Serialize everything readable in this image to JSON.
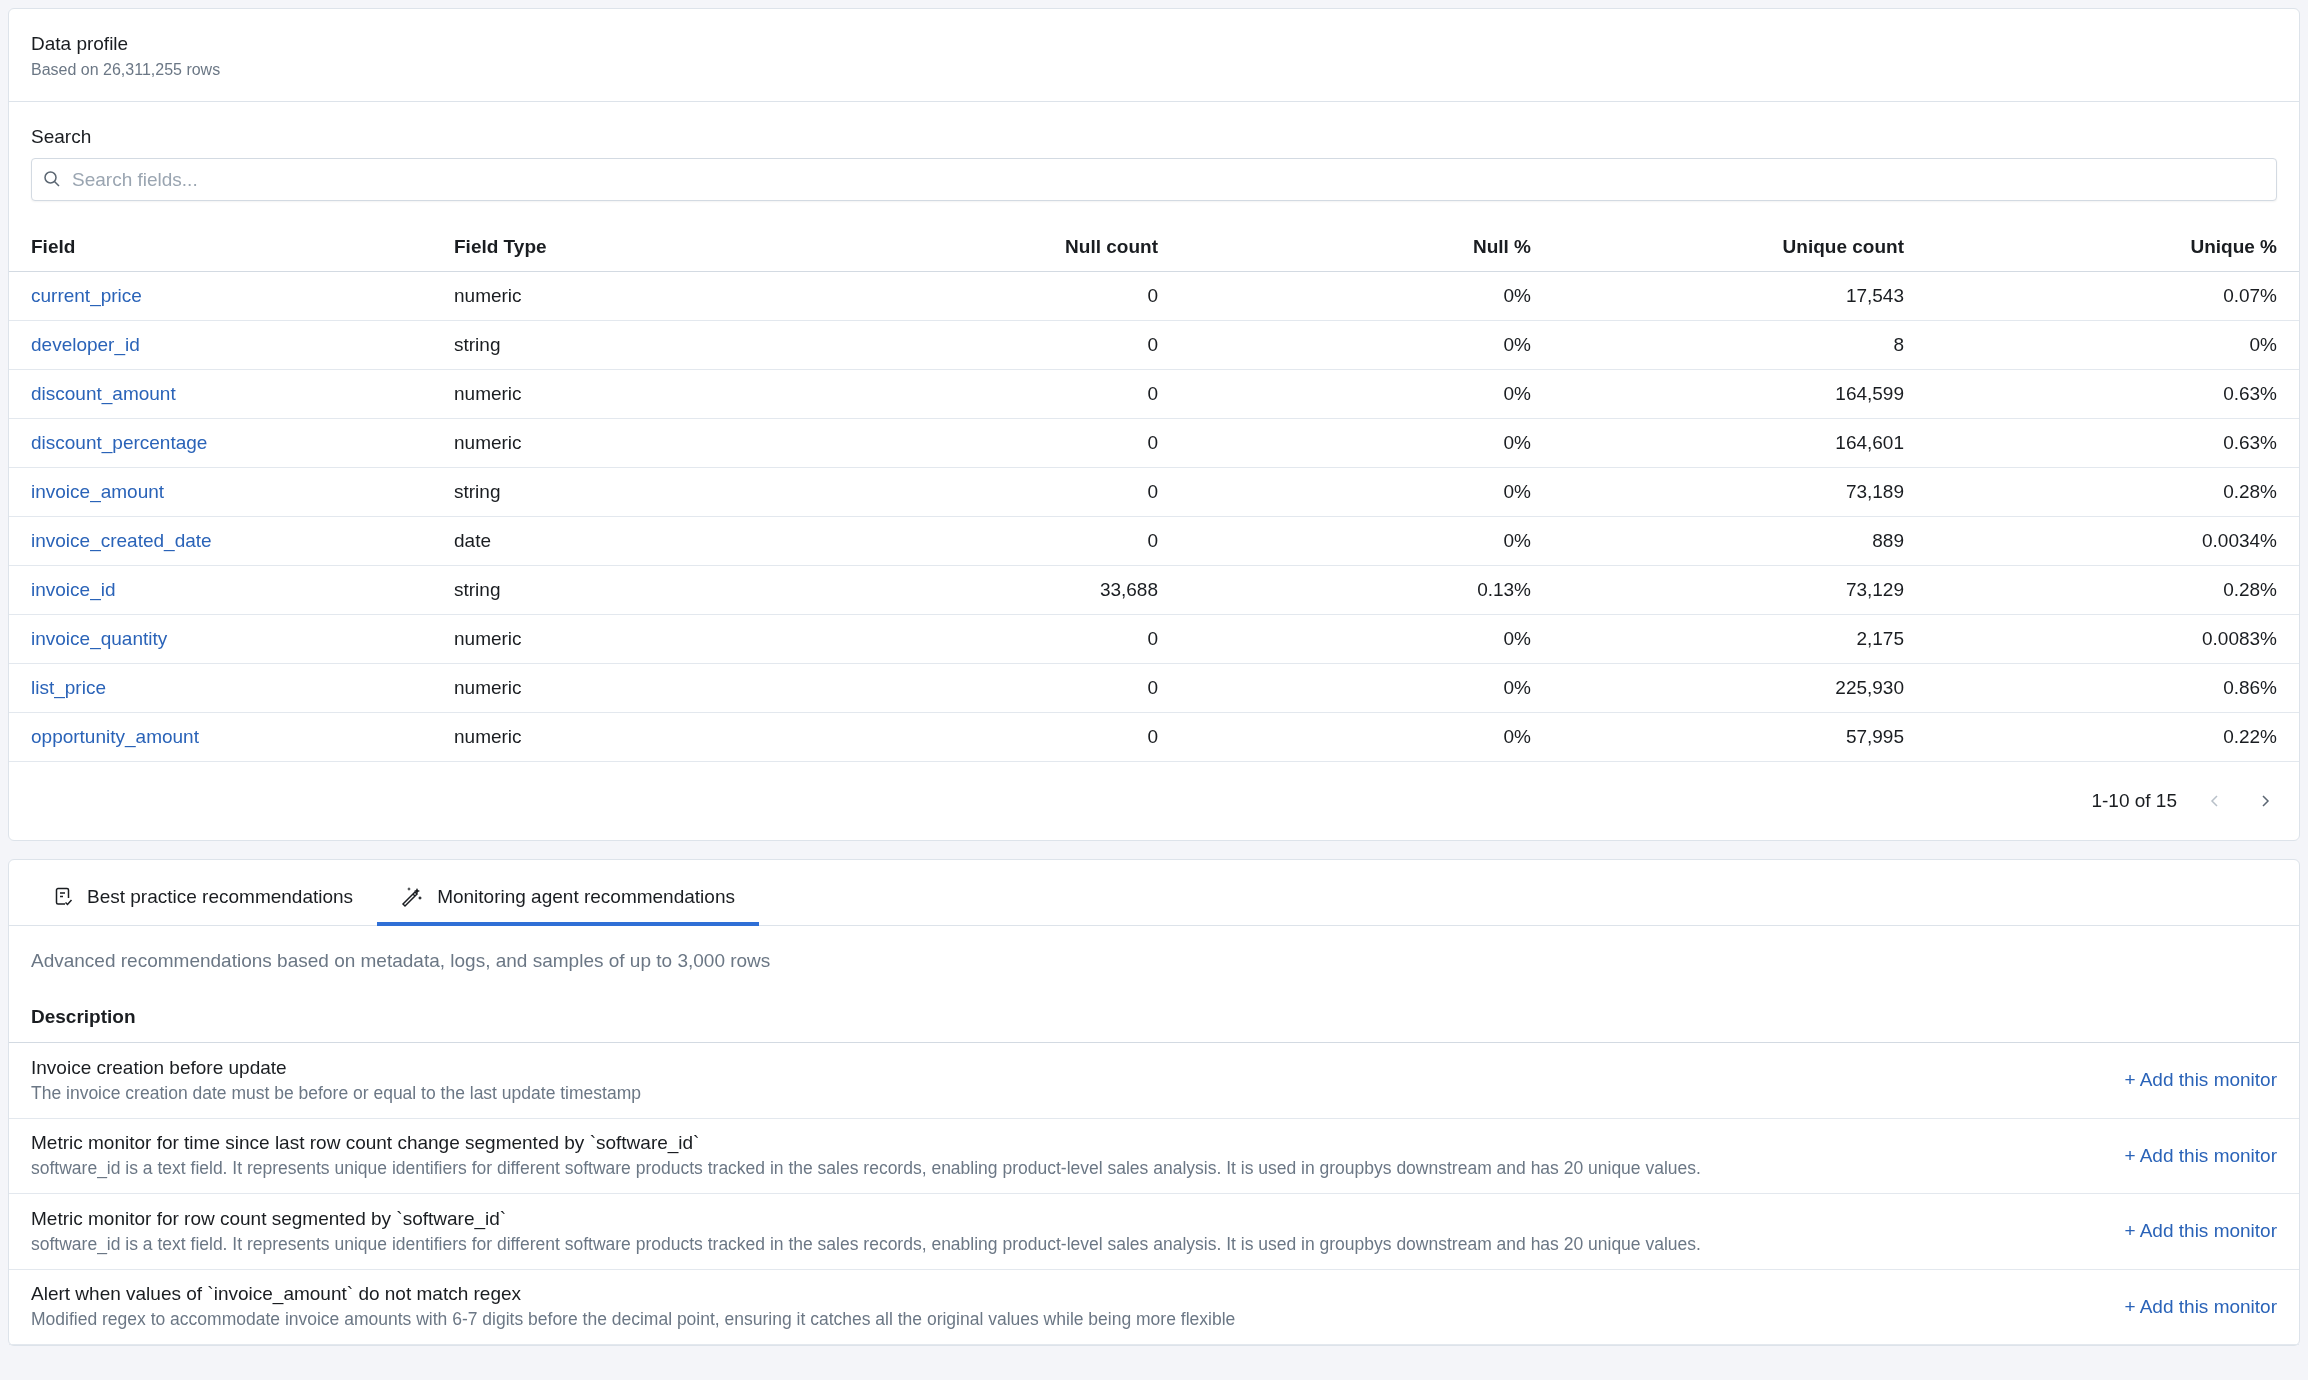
{
  "profile": {
    "title": "Data profile",
    "subtitle": "Based on 26,311,255 rows",
    "search": {
      "label": "Search",
      "placeholder": "Search fields..."
    },
    "table": {
      "columns": [
        "Field",
        "Field Type",
        "Null count",
        "Null %",
        "Unique count",
        "Unique %"
      ],
      "rows": [
        {
          "field": "current_price",
          "type": "numeric",
          "null_count": "0",
          "null_pct": "0%",
          "unique_count": "17,543",
          "unique_pct": "0.07%"
        },
        {
          "field": "developer_id",
          "type": "string",
          "null_count": "0",
          "null_pct": "0%",
          "unique_count": "8",
          "unique_pct": "0%"
        },
        {
          "field": "discount_amount",
          "type": "numeric",
          "null_count": "0",
          "null_pct": "0%",
          "unique_count": "164,599",
          "unique_pct": "0.63%"
        },
        {
          "field": "discount_percentage",
          "type": "numeric",
          "null_count": "0",
          "null_pct": "0%",
          "unique_count": "164,601",
          "unique_pct": "0.63%"
        },
        {
          "field": "invoice_amount",
          "type": "string",
          "null_count": "0",
          "null_pct": "0%",
          "unique_count": "73,189",
          "unique_pct": "0.28%"
        },
        {
          "field": "invoice_created_date",
          "type": "date",
          "null_count": "0",
          "null_pct": "0%",
          "unique_count": "889",
          "unique_pct": "0.0034%"
        },
        {
          "field": "invoice_id",
          "type": "string",
          "null_count": "33,688",
          "null_pct": "0.13%",
          "unique_count": "73,129",
          "unique_pct": "0.28%"
        },
        {
          "field": "invoice_quantity",
          "type": "numeric",
          "null_count": "0",
          "null_pct": "0%",
          "unique_count": "2,175",
          "unique_pct": "0.0083%"
        },
        {
          "field": "list_price",
          "type": "numeric",
          "null_count": "0",
          "null_pct": "0%",
          "unique_count": "225,930",
          "unique_pct": "0.86%"
        },
        {
          "field": "opportunity_amount",
          "type": "numeric",
          "null_count": "0",
          "null_pct": "0%",
          "unique_count": "57,995",
          "unique_pct": "0.22%"
        }
      ]
    },
    "pagination": {
      "range": "1-10 of 15",
      "prev_disabled": true,
      "next_disabled": false
    }
  },
  "recommendations": {
    "tabs": [
      {
        "label": "Best practice recommendations",
        "kind": "checklist",
        "selected": false
      },
      {
        "label": "Monitoring agent recommendations",
        "kind": "wand",
        "selected": true
      }
    ],
    "intro": "Advanced recommendations based on metadata, logs, and samples of up to 3,000 rows",
    "column": "Description",
    "items": [
      {
        "title": "Invoice creation before update",
        "description": "The invoice creation date must be before or equal to the last update timestamp",
        "action": "+ Add this monitor"
      },
      {
        "title": "Metric monitor for time since last row count change segmented by `software_id`",
        "description": "software_id is a text field. It represents unique identifiers for different software products tracked in the sales records, enabling product-level sales analysis. It is used in groupbys downstream and has 20 unique values.",
        "action": "+ Add this monitor"
      },
      {
        "title": "Metric monitor for row count segmented by `software_id`",
        "description": "software_id is a text field. It represents unique identifiers for different software products tracked in the sales records, enabling product-level sales analysis. It is used in groupbys downstream and has 20 unique values.",
        "action": "+ Add this monitor"
      },
      {
        "title": "Alert when values of `invoice_amount` do not match regex",
        "description": "Modified regex to accommodate invoice amounts with 6-7 digits before the decimal point, ensuring it catches all the original values while being more flexible",
        "action": "+ Add this monitor"
      }
    ]
  }
}
